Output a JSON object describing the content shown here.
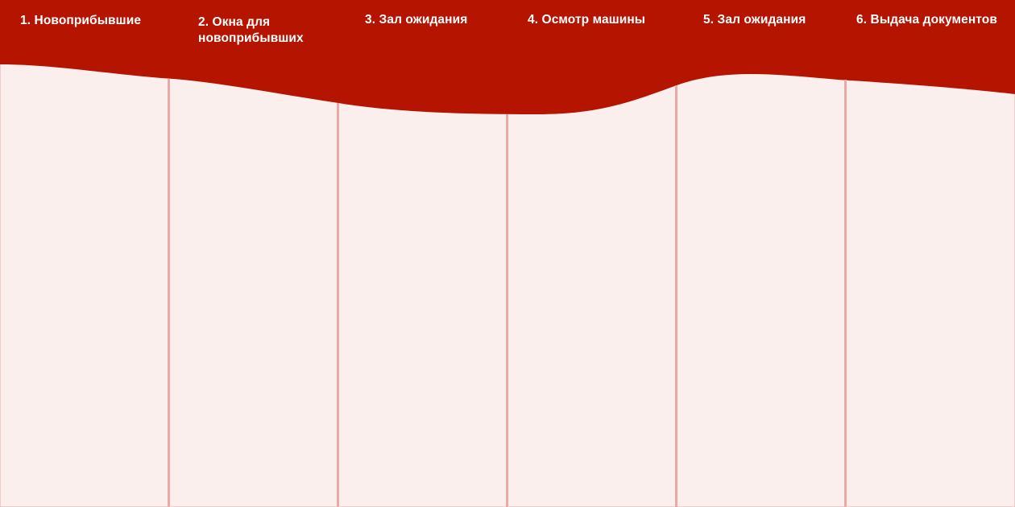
{
  "colors": {
    "header": "#b51500",
    "column_fill": "#fbefee",
    "divider": "#eba9a6",
    "label_text": "#ffffff"
  },
  "stages": [
    {
      "label": "1. Новоприбывшие"
    },
    {
      "label": "2. Окна для\nновоприбывших"
    },
    {
      "label": "3. Зал ожидания"
    },
    {
      "label": "4. Осмотр машины"
    },
    {
      "label": "5. Зал ожидания"
    },
    {
      "label": "6. Выдача документов"
    }
  ]
}
